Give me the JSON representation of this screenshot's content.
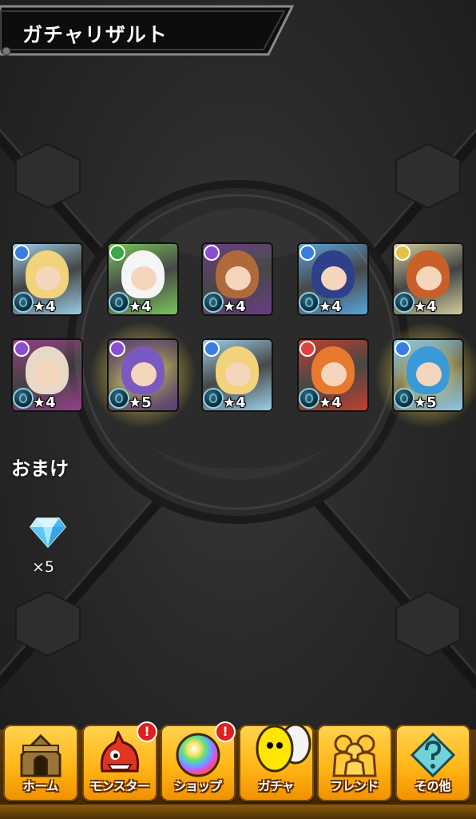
{
  "header": {
    "title": "ガチャリザルト"
  },
  "results": [
    {
      "stars": "★4",
      "attr_color": "#3a7de0",
      "portrait_bg": "#9fd5f0",
      "portrait_fg": "#f2d27a",
      "glow": false
    },
    {
      "stars": "★4",
      "attr_color": "#39a845",
      "portrait_bg": "#7ccc5a",
      "portrait_fg": "#f5f5f5",
      "glow": false
    },
    {
      "stars": "★4",
      "attr_color": "#8a4dd0",
      "portrait_bg": "#6a3c86",
      "portrait_fg": "#b0693a",
      "glow": false
    },
    {
      "stars": "★4",
      "attr_color": "#3a7de0",
      "portrait_bg": "#5aa9e3",
      "portrait_fg": "#2f3f8a",
      "glow": false
    },
    {
      "stars": "★4",
      "attr_color": "#e4c24a",
      "portrait_bg": "#d8d2a0",
      "portrait_fg": "#c9602a",
      "glow": false
    },
    {
      "stars": "★4",
      "attr_color": "#8a4dd0",
      "portrait_bg": "#9a3f8c",
      "portrait_fg": "#e8d8c8",
      "glow": false
    },
    {
      "stars": "★5",
      "attr_color": "#8a4dd0",
      "portrait_bg": "#5b3f7a",
      "portrait_fg": "#7a5ac0",
      "glow": true
    },
    {
      "stars": "★4",
      "attr_color": "#3a7de0",
      "portrait_bg": "#9fd5f0",
      "portrait_fg": "#f2d27a",
      "glow": false
    },
    {
      "stars": "★4",
      "attr_color": "#e04040",
      "portrait_bg": "#c8402a",
      "portrait_fg": "#e87a30",
      "glow": false
    },
    {
      "stars": "★5",
      "attr_color": "#3a7de0",
      "portrait_bg": "#8fd0f0",
      "portrait_fg": "#3a9ad8",
      "glow": true
    }
  ],
  "bonus": {
    "label": "おまけ",
    "gem_count": "×5",
    "gem_icon": "gem-icon"
  },
  "nav": [
    {
      "label": "ホーム",
      "icon": "home-icon",
      "badge": ""
    },
    {
      "label": "モンスター",
      "icon": "monster-icon",
      "badge": "!"
    },
    {
      "label": "ショップ",
      "icon": "shop-orb-icon",
      "badge": "!"
    },
    {
      "label": "ガチャ",
      "icon": "gacha-egg-icon",
      "badge": ""
    },
    {
      "label": "フレンド",
      "icon": "friend-icon",
      "badge": ""
    },
    {
      "label": "その他",
      "icon": "other-icon",
      "badge": ""
    }
  ],
  "colors": {
    "nav_button": "#ffb616",
    "badge": "#e02020",
    "glow": "#ffe050"
  }
}
